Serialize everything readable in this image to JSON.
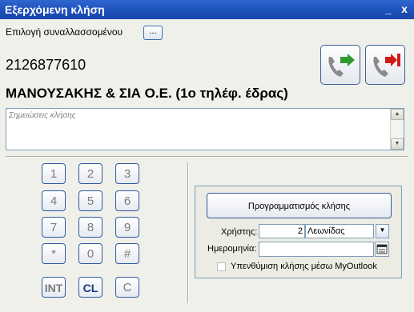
{
  "window": {
    "title": "Εξερχόμενη κλήση",
    "minimize": "_",
    "close": "x"
  },
  "contact_picker": {
    "label": "Επιλογή συναλλασσομένου",
    "button_label": "..."
  },
  "phone_number": "2126877610",
  "company_name": "ΜΑΝΟΥΣΑΚΗΣ & ΣΙΑ Ο.Ε. (1ο τηλέφ. έδρας)",
  "notes": {
    "placeholder": "Σημειώσεις κλήσης"
  },
  "keypad": {
    "keys": [
      "1",
      "2",
      "3",
      "4",
      "5",
      "6",
      "7",
      "8",
      "9",
      "*",
      "0",
      "#"
    ],
    "int_label": "INT",
    "cl_label": "CL",
    "c_label": "C"
  },
  "schedule": {
    "button_label": "Προγραμματισμός κλήσης",
    "user_label": "Χρήστης:",
    "user_id": "2",
    "user_name": "Λεωνίδας",
    "date_label": "Ημερομηνία:",
    "date_value": "",
    "reminder_label": "Υπενθύμιση κλήσης μέσω MyOutlook",
    "reminder_checked": false
  },
  "colors": {
    "title_bar": "#1c4fb8",
    "call_green": "#2e9b2e",
    "hangup_red": "#d01b1b"
  }
}
